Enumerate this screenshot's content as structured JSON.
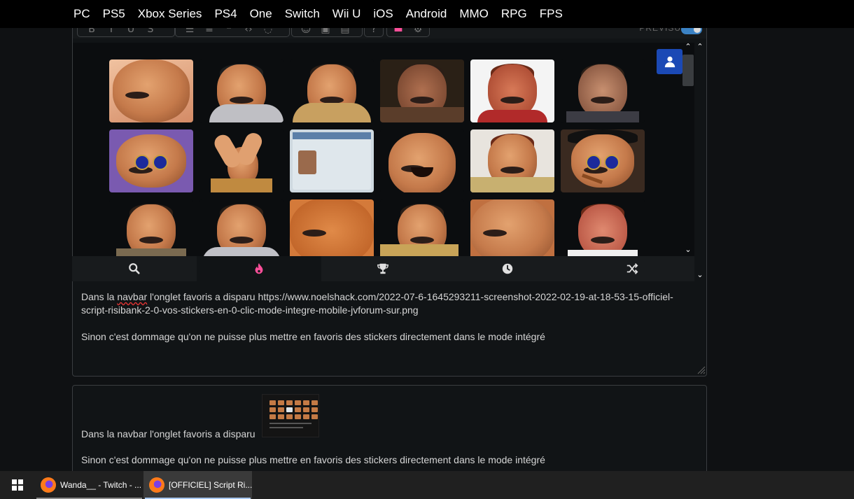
{
  "nav": {
    "items": [
      "PC",
      "PS5",
      "Xbox Series",
      "PS4",
      "One",
      "Switch",
      "Wii U",
      "iOS",
      "Android",
      "MMO",
      "RPG",
      "FPS"
    ]
  },
  "toolbar": {
    "buttons": [
      "bold-icon",
      "italic-icon",
      "underline-icon",
      "strikethrough-icon",
      "bullet-list-icon",
      "numbered-list-icon",
      "quote-icon",
      "code-icon",
      "spoiler-icon",
      "emoji-icon",
      "image-icon",
      "video-icon",
      "help-icon",
      "risibank-icon",
      "settings-icon"
    ],
    "preview_label": "PREVISU",
    "preview_enabled": true
  },
  "stickers": {
    "rows": [
      [
        "closeup-face",
        "laughing-grey",
        "laughing-suit",
        "facepalm-laugh",
        "smirk-red",
        "smile-dark"
      ],
      [
        "blue-glasses",
        "clapping",
        "id-card",
        "big-laugh",
        "thinking",
        "glasses-cigar"
      ],
      [
        "pointing",
        "laughing-grey-2",
        "closeup-orange",
        "bent-laugh",
        "closeup-smile",
        "hands-face"
      ]
    ]
  },
  "categories": [
    "search-icon",
    "fire-icon",
    "trophy-icon",
    "clock-icon",
    "shuffle-icon"
  ],
  "active_category": 1,
  "editor": {
    "line1_pre": "Dans la ",
    "line1_misspelled": "navbar",
    "line1_post": " l'onglet favoris a disparu  https://www.noelshack.com/2022-07-6-1645293211-screenshot-2022-02-19-at-18-53-15-officiel-script-risibank-2-0-vos-stickers-en-0-clic-mode-integre-mobile-jvforum-sur.png",
    "line2": "Sinon c'est dommage qu'on ne puisse plus mettre en favoris des stickers directement dans le mode intégré"
  },
  "preview": {
    "line1": "Dans la navbar l'onglet favoris a disparu",
    "line2": "Sinon c'est dommage qu'on ne puisse plus mettre en favoris des stickers directement dans le mode intégré"
  },
  "taskbar": {
    "tasks": [
      {
        "label": "Wanda__ - Twitch - ...",
        "icon": "firefox-icon",
        "active": false
      },
      {
        "label": "[OFFICIEL] Script Ri...",
        "icon": "firefox-icon",
        "active": true
      }
    ]
  },
  "colors": {
    "accent_blue": "#1b49b5",
    "fire_pink": "#ff4f9a",
    "background": "#0f1113"
  }
}
